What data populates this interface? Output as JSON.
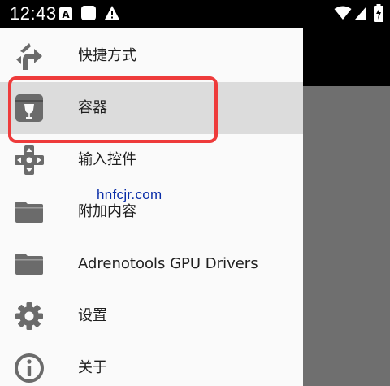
{
  "status_bar": {
    "time": "12:43"
  },
  "menu": {
    "items": [
      {
        "label": "快捷方式",
        "icon": "shortcut-arrow-icon"
      },
      {
        "label": "容器",
        "icon": "wine-container-icon",
        "selected": true
      },
      {
        "label": "输入控件",
        "icon": "dpad-icon"
      },
      {
        "label": "附加内容",
        "icon": "folder-icon"
      },
      {
        "label": "Adrenotools GPU Drivers",
        "icon": "folder-icon"
      },
      {
        "label": "设置",
        "icon": "gear-icon"
      },
      {
        "label": "关于",
        "icon": "info-icon"
      }
    ]
  },
  "watermark": "hnfcjr.com",
  "colors": {
    "highlight": "#ee3b3b",
    "icon": "#6b6b6b",
    "selected_bg": "#dcdcdc",
    "drawer_bg": "#fafafa",
    "scrim": "#6f6f6f"
  }
}
